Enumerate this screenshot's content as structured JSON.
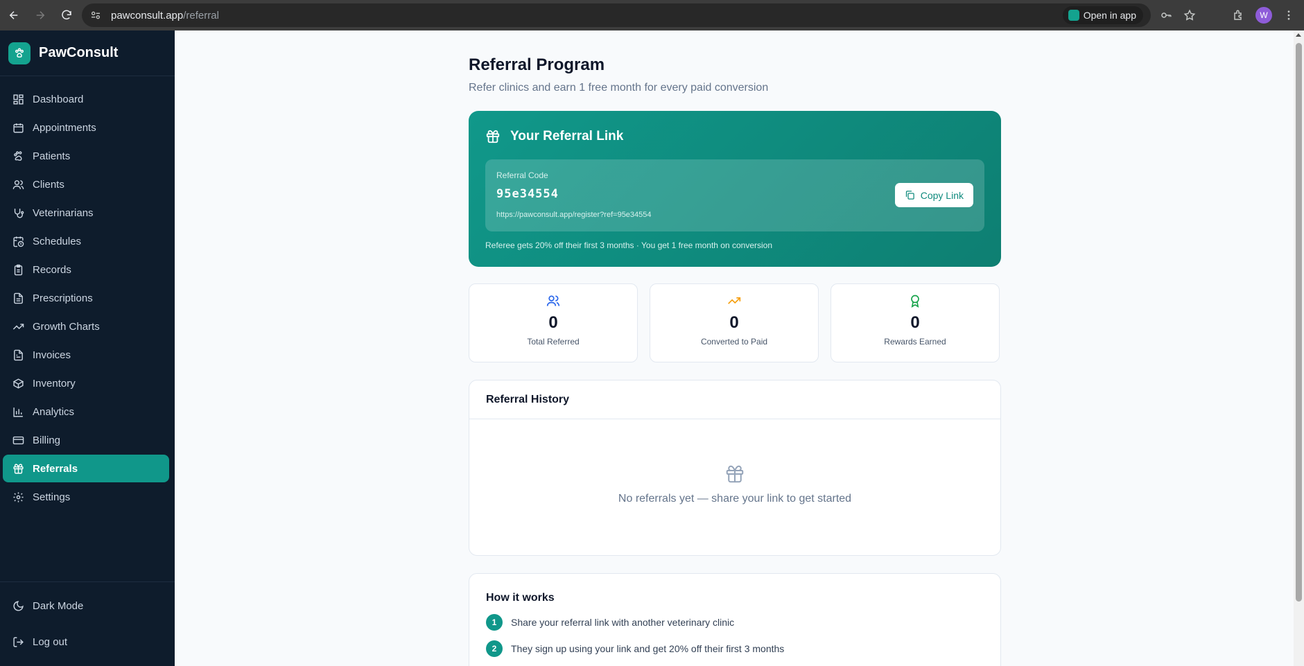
{
  "browser": {
    "url_host": "pawconsult.app",
    "url_path": "/referral",
    "open_in_app": "Open in app",
    "profile_initial": "W"
  },
  "sidebar": {
    "brand": "PawConsult",
    "items": [
      {
        "label": "Dashboard",
        "icon": "dashboard-icon"
      },
      {
        "label": "Appointments",
        "icon": "calendar-icon"
      },
      {
        "label": "Patients",
        "icon": "paw-icon"
      },
      {
        "label": "Clients",
        "icon": "users-icon"
      },
      {
        "label": "Veterinarians",
        "icon": "stethoscope-icon"
      },
      {
        "label": "Schedules",
        "icon": "calendar-clock-icon"
      },
      {
        "label": "Records",
        "icon": "clipboard-icon"
      },
      {
        "label": "Prescriptions",
        "icon": "file-text-icon"
      },
      {
        "label": "Growth Charts",
        "icon": "trending-up-icon"
      },
      {
        "label": "Invoices",
        "icon": "receipt-icon"
      },
      {
        "label": "Inventory",
        "icon": "package-icon"
      },
      {
        "label": "Analytics",
        "icon": "bar-chart-icon"
      },
      {
        "label": "Billing",
        "icon": "credit-card-icon"
      },
      {
        "label": "Referrals",
        "icon": "gift-icon",
        "active": true
      },
      {
        "label": "Settings",
        "icon": "gear-icon"
      }
    ],
    "dark_mode": "Dark Mode",
    "logout": "Log out"
  },
  "page": {
    "title": "Referral Program",
    "subtitle": "Refer clinics and earn 1 free month for every paid conversion"
  },
  "referral": {
    "heading": "Your Referral Link",
    "code_label": "Referral Code",
    "code": "95e34554",
    "url": "https://pawconsult.app/register?ref=95e34554",
    "copy_label": "Copy Link",
    "note": "Referee gets 20% off their first 3 months · You get 1 free month on conversion"
  },
  "stats": [
    {
      "value": "0",
      "label": "Total Referred",
      "icon": "users-icon",
      "color": "#2563eb"
    },
    {
      "value": "0",
      "label": "Converted to Paid",
      "icon": "trending-up-icon",
      "color": "#f59e0b"
    },
    {
      "value": "0",
      "label": "Rewards Earned",
      "icon": "award-icon",
      "color": "#16a34a"
    }
  ],
  "history": {
    "title": "Referral History",
    "empty_text": "No referrals yet — share your link to get started"
  },
  "how_it_works": {
    "title": "How it works",
    "steps": [
      {
        "num": "1",
        "text": "Share your referral link with another veterinary clinic"
      },
      {
        "num": "2",
        "text": "They sign up using your link and get 20% off their first 3 months"
      }
    ]
  },
  "colors": {
    "accent": "#10978a",
    "sidebar_bg": "#0e1c2c"
  }
}
